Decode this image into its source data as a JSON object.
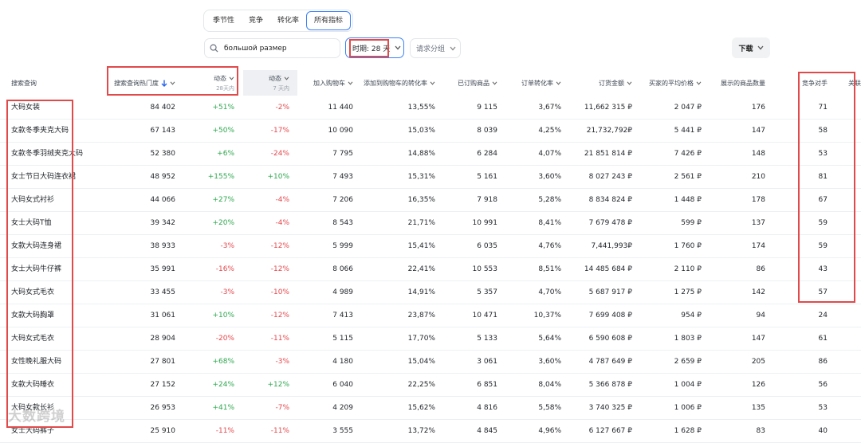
{
  "tabs": [
    "季节性",
    "竞争",
    "转化率",
    "所有指标"
  ],
  "active_tab": 3,
  "filters": {
    "search_value": "большой размер",
    "period_label": "时期: 28 天",
    "group_label": "请求分组",
    "download_label": "下载"
  },
  "columns": {
    "query": "搜索查询",
    "popularity": "搜索查询热门度",
    "dyn28": "动态",
    "dyn28_sub": "28天内",
    "dyn7": "动态",
    "dyn7_sub": "7 天内",
    "cart": "加入购物车",
    "cart_conv": "添加到购物车的转化率",
    "ordered": "已订购商品",
    "order_conv": "订单转化率",
    "order_sum": "订货金额",
    "avg_price": "买家的平均价格",
    "shown": "展示的商品数量",
    "competitors": "竞争对手",
    "extra": "关联"
  },
  "rows": [
    {
      "q": "大码女装",
      "pop": "84 402",
      "d28": "+51%",
      "d7": "-2%",
      "cart": "11 440",
      "cc": "13,55%",
      "ord": "9 115",
      "oc": "3,67%",
      "sum": "11,662 315 ₽",
      "avg": "2 047 ₽",
      "shown": "176",
      "comp": "71"
    },
    {
      "q": "女款冬季夹克大码",
      "pop": "67 143",
      "d28": "+50%",
      "d7": "-17%",
      "cart": "10 090",
      "cc": "15,03%",
      "ord": "8 039",
      "oc": "4,25%",
      "sum": "21,732,792₽",
      "avg": "5 441 ₽",
      "shown": "147",
      "comp": "58"
    },
    {
      "q": "女款冬季羽绒夹克大码",
      "pop": "52 380",
      "d28": "+6%",
      "d7": "-24%",
      "cart": "7 795",
      "cc": "14,88%",
      "ord": "6 284",
      "oc": "4,07%",
      "sum": "21 851 814 ₽",
      "avg": "7 426 ₽",
      "shown": "148",
      "comp": "53"
    },
    {
      "q": "女士节日大码连衣裙",
      "pop": "48 952",
      "d28": "+155%",
      "d7": "+10%",
      "cart": "7 493",
      "cc": "15,31%",
      "ord": "5 161",
      "oc": "3,60%",
      "sum": "8 027 243 ₽",
      "avg": "2 561 ₽",
      "shown": "210",
      "comp": "81"
    },
    {
      "q": "大码女式衬衫",
      "pop": "44 066",
      "d28": "+27%",
      "d7": "-4%",
      "cart": "7 206",
      "cc": "16,35%",
      "ord": "7 918",
      "oc": "5,28%",
      "sum": "8 834 824 ₽",
      "avg": "1 448 ₽",
      "shown": "178",
      "comp": "67"
    },
    {
      "q": "女士大码T恤",
      "pop": "39 342",
      "d28": "+20%",
      "d7": "-4%",
      "cart": "8 543",
      "cc": "21,71%",
      "ord": "10 991",
      "oc": "8,41%",
      "sum": "7 679 478 ₽",
      "avg": "599 ₽",
      "shown": "137",
      "comp": "59"
    },
    {
      "q": "女款大码连身裙",
      "pop": "38 933",
      "d28": "-3%",
      "d7": "-12%",
      "cart": "5 999",
      "cc": "15,41%",
      "ord": "6 035",
      "oc": "4,76%",
      "sum": "7,441,993₽",
      "avg": "1 760 ₽",
      "shown": "174",
      "comp": "59"
    },
    {
      "q": "女士大码牛仔裤",
      "pop": "35 991",
      "d28": "-16%",
      "d7": "-12%",
      "cart": "8 066",
      "cc": "22,41%",
      "ord": "10 553",
      "oc": "8,51%",
      "sum": "14 485 684 ₽",
      "avg": "2 110 ₽",
      "shown": "86",
      "comp": "43"
    },
    {
      "q": "大码女式毛衣",
      "pop": "33 455",
      "d28": "-3%",
      "d7": "-10%",
      "cart": "4 989",
      "cc": "14,91%",
      "ord": "5 357",
      "oc": "4,70%",
      "sum": "5 687 917 ₽",
      "avg": "1 275 ₽",
      "shown": "142",
      "comp": "57"
    },
    {
      "q": "女款大码胸罩",
      "pop": "31 061",
      "d28": "+10%",
      "d7": "-12%",
      "cart": "7 413",
      "cc": "23,87%",
      "ord": "10 471",
      "oc": "10,37%",
      "sum": "7 699 408 ₽",
      "avg": "954 ₽",
      "shown": "94",
      "comp": "24"
    },
    {
      "q": "大码女式毛衣",
      "pop": "28 904",
      "d28": "-20%",
      "d7": "-11%",
      "cart": "5 115",
      "cc": "17,70%",
      "ord": "5 133",
      "oc": "5,64%",
      "sum": "6 590 608 ₽",
      "avg": "1 803 ₽",
      "shown": "147",
      "comp": "61"
    },
    {
      "q": "女性晚礼服大码",
      "pop": "27 801",
      "d28": "+68%",
      "d7": "-3%",
      "cart": "4 180",
      "cc": "15,04%",
      "ord": "3 061",
      "oc": "3,60%",
      "sum": "4 787 649 ₽",
      "avg": "2 659 ₽",
      "shown": "205",
      "comp": "86"
    },
    {
      "q": "女款大码睡衣",
      "pop": "27 152",
      "d28": "+24%",
      "d7": "+12%",
      "cart": "6 040",
      "cc": "22,25%",
      "ord": "6 851",
      "oc": "8,04%",
      "sum": "5 366 878 ₽",
      "avg": "1 004 ₽",
      "shown": "126",
      "comp": "56"
    },
    {
      "q": "大码女款长衫",
      "pop": "26 953",
      "d28": "+41%",
      "d7": "-7%",
      "cart": "4 209",
      "cc": "15,62%",
      "ord": "4 816",
      "oc": "5,58%",
      "sum": "3 740 325 ₽",
      "avg": "1 006 ₽",
      "shown": "135",
      "comp": "53"
    },
    {
      "q": "女士大码裤子",
      "pop": "25 910",
      "d28": "-11%",
      "d7": "-11%",
      "cart": "3 555",
      "cc": "13,72%",
      "ord": "4 845",
      "oc": "4,96%",
      "sum": "6 127 667 ₽",
      "avg": "1 628 ₽",
      "shown": "83",
      "comp": "40"
    }
  ],
  "watermark": "大数跨境"
}
